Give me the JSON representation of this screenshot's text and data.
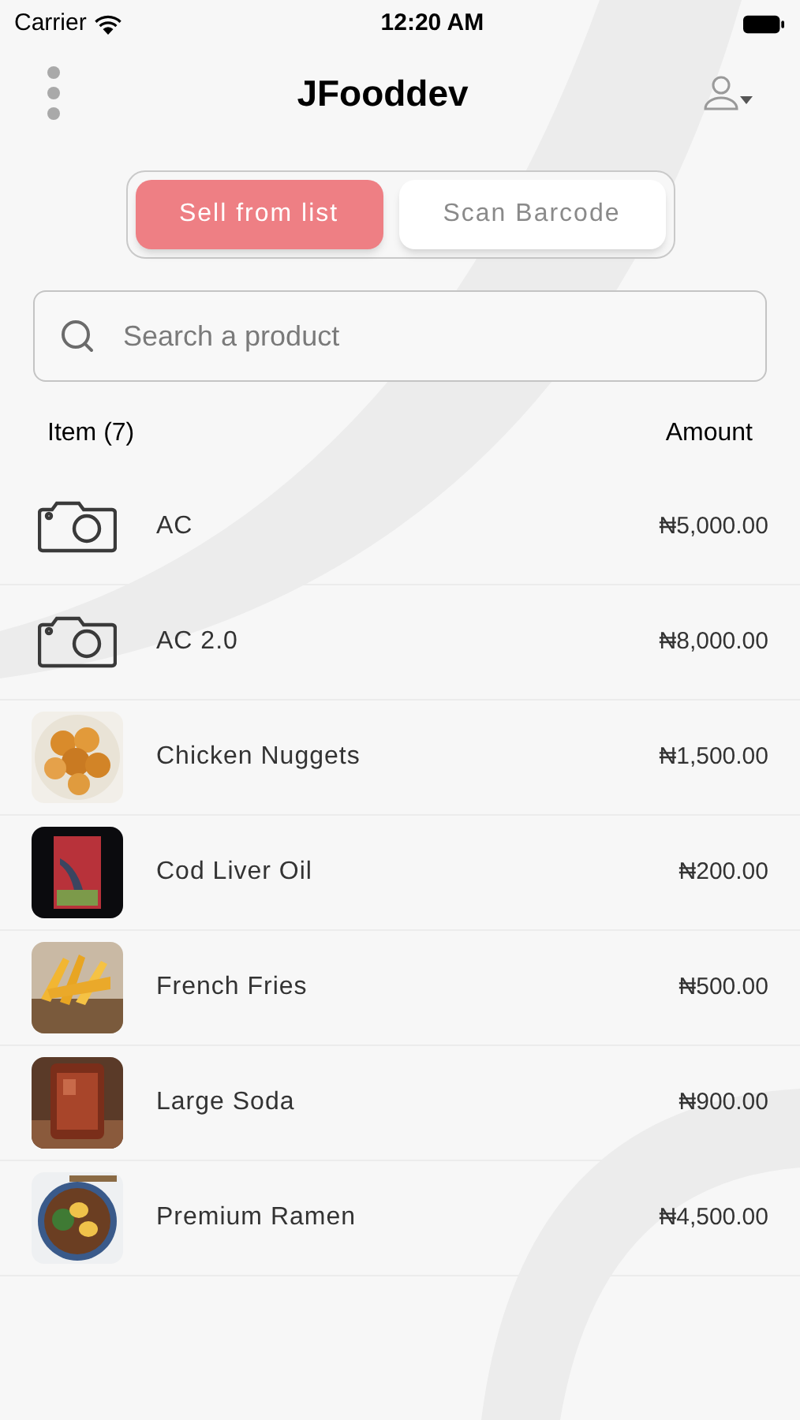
{
  "status_bar": {
    "carrier": "Carrier",
    "time": "12:20 AM"
  },
  "header": {
    "title": "JFooddev"
  },
  "tabs": [
    {
      "label": "Sell from list",
      "selected": true
    },
    {
      "label": "Scan Barcode",
      "selected": false
    }
  ],
  "search": {
    "placeholder": "Search a product"
  },
  "list_header": {
    "item": "Item (7)",
    "amount": "Amount"
  },
  "products": [
    {
      "kind": "camera",
      "name": "AC",
      "price": "₦5,000.00"
    },
    {
      "kind": "camera",
      "name": "AC 2.0",
      "price": "₦8,000.00"
    },
    {
      "kind": "picture",
      "name": "Chicken Nuggets",
      "price": "₦1,500.00"
    },
    {
      "kind": "picture",
      "name": "Cod Liver Oil",
      "price": "₦200.00"
    },
    {
      "kind": "picture",
      "name": "French Fries",
      "price": "₦500.00"
    },
    {
      "kind": "picture",
      "name": "Large Soda",
      "price": "₦900.00"
    },
    {
      "kind": "picture",
      "name": "Premium Ramen",
      "price": "₦4,500.00"
    }
  ]
}
